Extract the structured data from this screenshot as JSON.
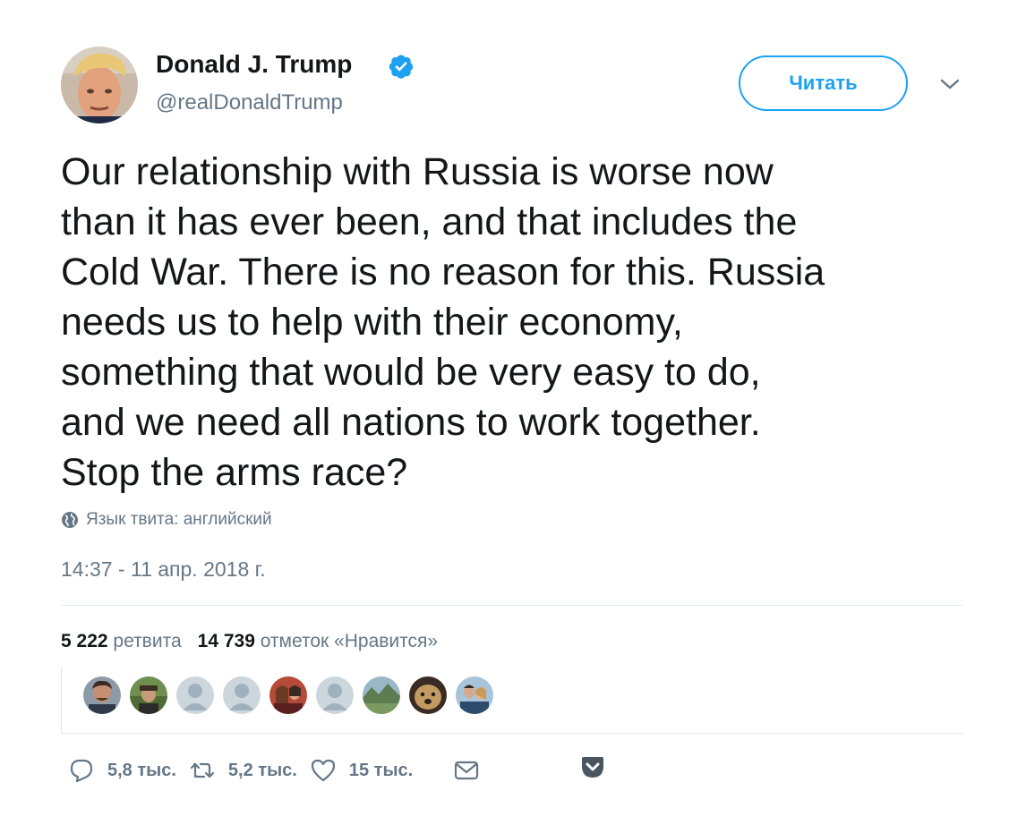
{
  "author": {
    "name": "Donald J. Trump",
    "handle": "@realDonaldTrump",
    "verified": true
  },
  "follow_button": {
    "label": "Читать"
  },
  "tweet": {
    "text": "Our relationship with Russia is worse now\nthan it has ever been, and that includes the\nCold War. There is no reason for this. Russia\nneeds us to help with their economy,\nsomething that would be very easy to do,\nand we need all nations to work together.\nStop the arms race?",
    "language": "Язык твита: английский",
    "timestamp": "14:37 - 11 апр. 2018 г."
  },
  "stats": {
    "retweets_count": "5 222",
    "retweets_label": "ретвита",
    "likes_count": "14 739",
    "likes_label": "отметок «Нравится»"
  },
  "likers": [
    {
      "kind": "photo"
    },
    {
      "kind": "photo"
    },
    {
      "kind": "default"
    },
    {
      "kind": "default"
    },
    {
      "kind": "photo"
    },
    {
      "kind": "default"
    },
    {
      "kind": "landscape"
    },
    {
      "kind": "dog"
    },
    {
      "kind": "photo"
    }
  ],
  "actions": {
    "replies": "5,8 тыс.",
    "retweets": "5,2 тыс.",
    "likes": "15 тыс."
  },
  "colors": {
    "accent": "#1da1f2",
    "text": "#14171a",
    "secondary": "#657786",
    "border": "#e1e8ed"
  },
  "icons": [
    "verified-badge-icon",
    "chevron-down-icon",
    "globe-icon",
    "reply-icon",
    "retweet-icon",
    "heart-icon",
    "envelope-icon",
    "pocket-icon"
  ]
}
